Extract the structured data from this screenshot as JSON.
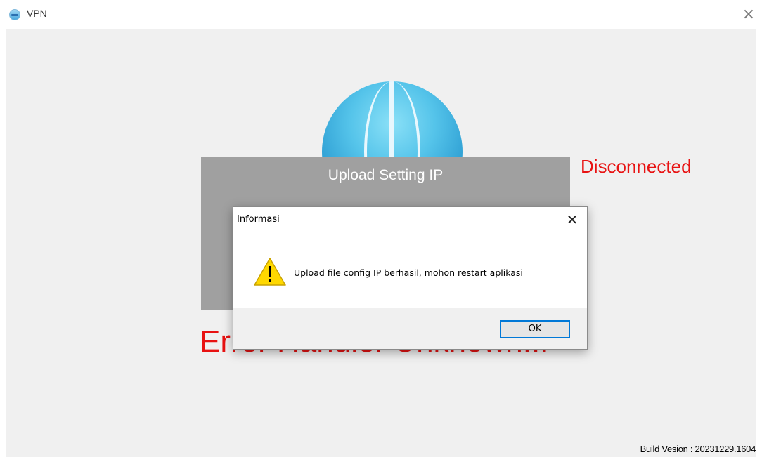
{
  "window": {
    "title": "VPN",
    "close_glyph": "×",
    "icon": "vpn-globe-icon"
  },
  "main": {
    "status": "Disconnected",
    "upload_button_label": "Upload Setting IP",
    "error_message": "Error Handler Unknown...",
    "build_version": "Build Vesion : 20231229.1604"
  },
  "dialog": {
    "title": "Informasi",
    "close_glyph": "✕",
    "icon": "warning-icon",
    "message": "Upload file config IP berhasil, mohon restart aplikasi",
    "ok_label": "OK"
  },
  "colors": {
    "status_red": "#e81212",
    "panel_gray": "#a0a0a0",
    "accent_blue": "#0078d7",
    "warning_yellow": "#ffd800"
  }
}
